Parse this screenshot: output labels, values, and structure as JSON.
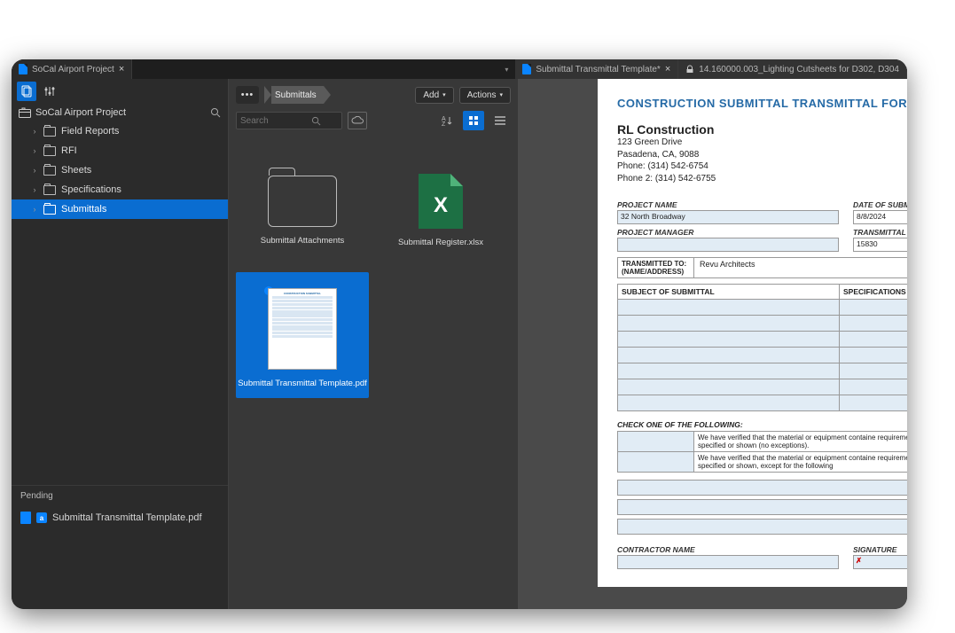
{
  "tabs": {
    "project": "SoCal Airport Project",
    "template": "Submittal Transmittal Template*",
    "locked": "14.160000.003_Lighting Cutsheets for D302, D304"
  },
  "sidebar": {
    "project_title": "SoCal Airport Project",
    "items": [
      {
        "label": "Field Reports"
      },
      {
        "label": "RFI"
      },
      {
        "label": "Sheets"
      },
      {
        "label": "Specifications"
      },
      {
        "label": "Submittals"
      }
    ]
  },
  "pending": {
    "header": "Pending",
    "file": "Submittal Transmittal Template.pdf"
  },
  "midpanel": {
    "breadcrumb": "Submittals",
    "add": "Add",
    "actions": "Actions",
    "search_placeholder": "Search",
    "files": [
      {
        "name": "Submittal Attachments"
      },
      {
        "name": "Submittal Register.xlsx"
      },
      {
        "name": "Submittal Transmittal Template.pdf"
      }
    ]
  },
  "form": {
    "title": "CONSTRUCTION SUBMITTAL TRANSMITTAL FORM",
    "company": "RL Construction",
    "addr1": "123 Green Drive",
    "addr2": "Pasadena, CA, 9088",
    "phone1": "Phone: (314) 542-6754",
    "phone2": "Phone 2: (314) 542-6755",
    "labels": {
      "project_name": "PROJECT NAME",
      "date": "DATE OF SUBMI",
      "pm": "PROJECT MANAGER",
      "tn": "TRANSMITTAL N",
      "tx_to": "TRANSMITTED TO:",
      "tx_to2": "(NAME/ADDRESS)",
      "subj": "SUBJECT OF SUBMITTAL",
      "spec": "SPECIFICATIONS",
      "check": "CHECK ONE OF THE FOLLOWING:",
      "chk1": "We have verified that the material or equipment containe requirements specified or shown (no exceptions).",
      "chk2": "We have verified that the material or equipment containe requirements specified or shown, except for the following",
      "contractor": "CONTRACTOR NAME",
      "sig": "SIGNATURE"
    },
    "values": {
      "project_name": "32 North Broadway",
      "date": "8/8/2024",
      "tn": "15830",
      "tx_to": "Revu Architects"
    }
  }
}
